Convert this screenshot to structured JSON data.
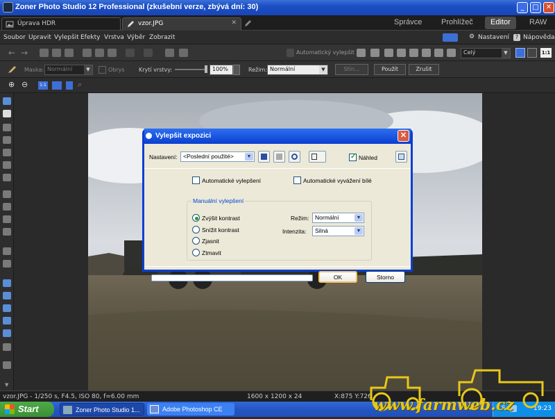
{
  "window": {
    "title": "Zoner Photo Studio 12 Professional (zkušební verze, zbývá dní: 30)",
    "btn_min": "_",
    "btn_max": "□",
    "btn_close": "✕"
  },
  "tabs": [
    {
      "label": "Úprava HDR"
    },
    {
      "label": "vzor.JPG"
    }
  ],
  "tab_close": "✕",
  "modes": {
    "spravce": "Správce",
    "prohlizec": "Prohlížeč",
    "editor": "Editor",
    "raw": "RAW"
  },
  "menu": [
    "Soubor",
    "Upravit",
    "Vylepšit",
    "Efekty",
    "Vrstva",
    "Výběr",
    "Zobrazit"
  ],
  "menu_right": {
    "settings": "Nastavení",
    "help": "Nápověda"
  },
  "toolbar1": {
    "auto_enhance": "Automatický vylepšit",
    "zoom_combo": "Celý",
    "one_to_one": "1:1"
  },
  "toolbar2": {
    "mask_label": "Maska:",
    "mask_value": "Normální",
    "obrys": "Obrys",
    "opacity_label": "Krytí vrstvy:",
    "opacity_value": "100%",
    "mode_label": "Režim:",
    "mode_value": "Normální",
    "shadow_btn": "Stín...",
    "apply_btn": "Použít",
    "cancel_btn": "Zrušit"
  },
  "toolbar3": {
    "fit_label": "1:1"
  },
  "status": {
    "file": "vzor.JPG - 1/250 s, F4.5, ISO 80, f=6.00 mm",
    "size": "1600 x 1200 x 24",
    "coords": "X:875 Y:726"
  },
  "taskbar": {
    "start": "Start",
    "tasks": [
      "Zoner Photo Studio 1...",
      "Adobe Photoshop CE"
    ],
    "lang": "CS",
    "time": "19:23"
  },
  "watermark": "www.farmweb.cz",
  "dialog": {
    "title": "Vylepšit expozici",
    "close": "✕",
    "settings_label": "Nastavení:",
    "settings_value": "<Poslední použité>",
    "preview_label": "Náhled",
    "preview_checked": true,
    "auto_enhance_label": "Automatické vylepšení",
    "auto_enhance_checked": false,
    "auto_wb_label": "Automatické vyvážení bílé",
    "auto_wb_checked": false,
    "manual_group": "Manuální vylepšení",
    "options": [
      {
        "label": "Zvýšit kontrast",
        "selected": true
      },
      {
        "label": "Snížit kontrast",
        "selected": false
      },
      {
        "label": "Zjasnit",
        "selected": false
      },
      {
        "label": "Ztmavit",
        "selected": false
      }
    ],
    "mode_label": "Režim:",
    "mode_value": "Normální",
    "intensity_label": "Intenzita:",
    "intensity_value": "Silná",
    "progress": 0,
    "ok": "OK",
    "cancel": "Storno"
  },
  "colors": {
    "accent": "#0a3fd1",
    "selected_radio": "#21a121",
    "watermark": "#e8c818"
  }
}
